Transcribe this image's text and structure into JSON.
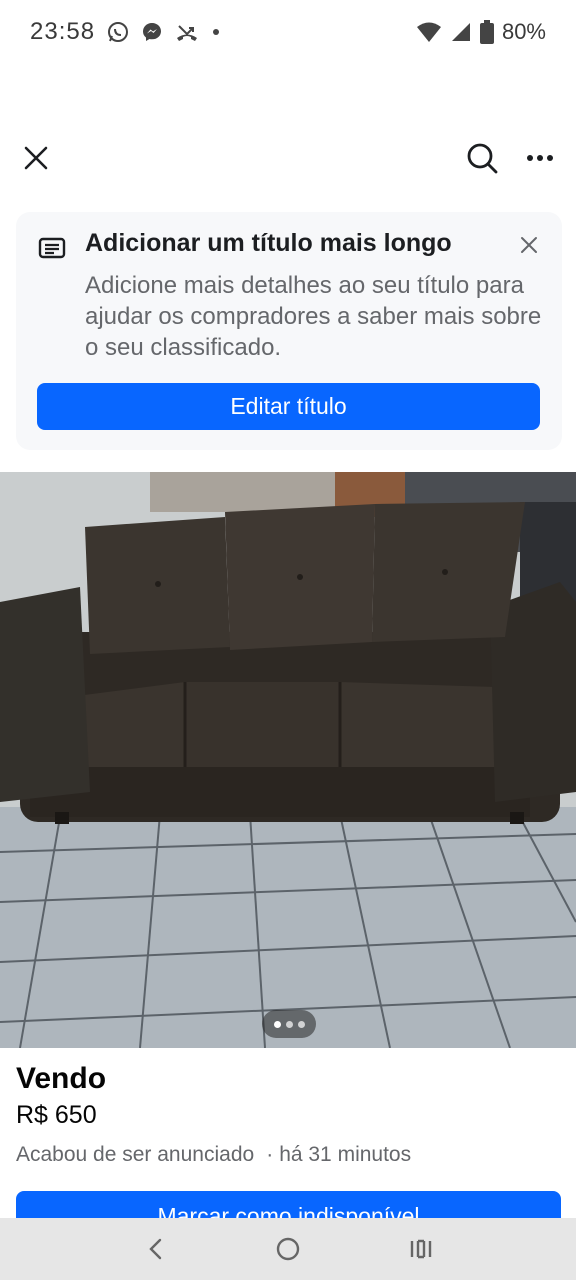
{
  "status_bar": {
    "time": "23:58",
    "battery": "80%",
    "icons_left": [
      "whatsapp-icon",
      "messenger-icon",
      "missed-call-icon",
      "dot-icon"
    ],
    "icons_right": [
      "wifi-icon",
      "signal-icon",
      "battery-icon"
    ]
  },
  "nav": {
    "icons": [
      "close-icon",
      "search-icon",
      "more-icon"
    ]
  },
  "suggestion": {
    "title": "Adicionar um título mais longo",
    "body": "Adicione mais detalhes ao seu título para ajudar os compradores a saber mais sobre o seu classificado.",
    "button_label": "Editar título",
    "accent": "#0866ff"
  },
  "photo": {
    "subject": "sofá",
    "page_dots": 3
  },
  "listing": {
    "title": "Vendo",
    "price": "R$ 650",
    "status": "Acabou de ser anunciado",
    "separator": "·",
    "time_ago": "há 31 minutos",
    "primary_button": "Marcar como indisponível"
  },
  "system_nav": {
    "icons": [
      "back-icon",
      "home-icon",
      "recents-icon"
    ]
  }
}
